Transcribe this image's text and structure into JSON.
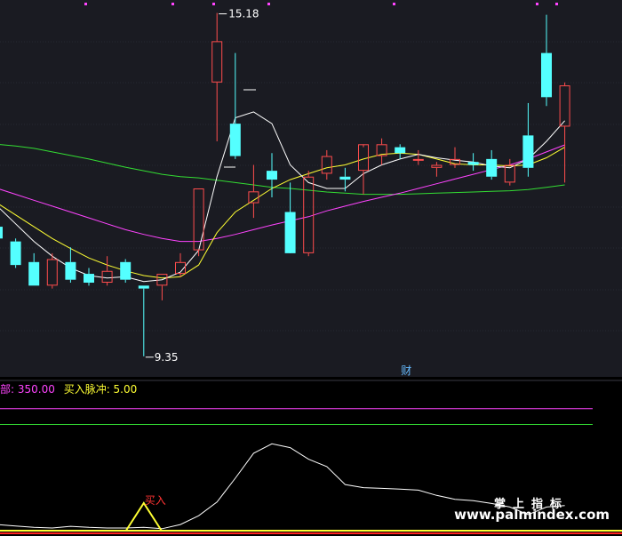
{
  "colors": {
    "background": "#000000",
    "panel_bg": "#1a1b22",
    "grid": "#262833",
    "candle_up": "#ff4d4d",
    "candle_down": "#54ffff",
    "ma_fast": "#ffffff",
    "ma_mid": "#ffff33",
    "ma_slow": "#ff44ff",
    "ma_long": "#33dd33",
    "label": "#ffffff",
    "legend_magenta": "#ff44ff",
    "legend_yellow": "#ffff33",
    "buy_label": "#ff3333",
    "signal_line": "#ffff33",
    "base_red": "#ff2222"
  },
  "main_chart": {
    "high_label": "15.18",
    "low_label": "9.35",
    "event_marker": "财"
  },
  "indicator": {
    "legend": [
      {
        "text": "部: 350.00",
        "color": "#ff44ff"
      },
      {
        "text": "买入脉冲: 5.00",
        "color": "#ffff33"
      }
    ],
    "buy_label": "买入"
  },
  "watermark": {
    "cn": "掌上指标",
    "url": "www.palmindex.com"
  },
  "chart_data": [
    {
      "type": "candlestick",
      "title": "",
      "price_range": [
        9.0,
        15.4
      ],
      "candles": [
        {
          "o": 11.55,
          "h": 11.65,
          "l": 11.35,
          "c": 11.35
        },
        {
          "o": 11.3,
          "h": 11.35,
          "l": 10.85,
          "c": 10.9
        },
        {
          "o": 10.95,
          "h": 11.1,
          "l": 10.55,
          "c": 10.55
        },
        {
          "o": 10.55,
          "h": 11.1,
          "l": 10.5,
          "c": 11.0
        },
        {
          "o": 10.95,
          "h": 11.2,
          "l": 10.6,
          "c": 10.65
        },
        {
          "o": 10.75,
          "h": 10.85,
          "l": 10.55,
          "c": 10.6
        },
        {
          "o": 10.6,
          "h": 11.05,
          "l": 10.55,
          "c": 10.8
        },
        {
          "o": 10.95,
          "h": 11.0,
          "l": 10.6,
          "c": 10.65
        },
        {
          "o": 10.55,
          "h": 10.55,
          "l": 9.35,
          "c": 10.5
        },
        {
          "o": 10.55,
          "h": 10.75,
          "l": 10.3,
          "c": 10.75
        },
        {
          "o": 10.75,
          "h": 11.1,
          "l": 10.7,
          "c": 10.95
        },
        {
          "o": 11.15,
          "h": 12.2,
          "l": 11.05,
          "c": 12.2
        },
        {
          "o": 14.0,
          "h": 15.18,
          "l": 13.0,
          "c": 14.7
        },
        {
          "o": 13.3,
          "h": 14.5,
          "l": 12.7,
          "c": 12.75
        },
        {
          "o": 11.95,
          "h": 12.6,
          "l": 11.7,
          "c": 12.15
        },
        {
          "o": 12.5,
          "h": 12.8,
          "l": 12.05,
          "c": 12.35
        },
        {
          "o": 11.8,
          "h": 12.3,
          "l": 11.5,
          "c": 11.1
        },
        {
          "o": 11.1,
          "h": 12.5,
          "l": 11.05,
          "c": 12.4
        },
        {
          "o": 12.45,
          "h": 12.85,
          "l": 12.35,
          "c": 12.75
        },
        {
          "o": 12.4,
          "h": 12.55,
          "l": 12.15,
          "c": 12.35
        },
        {
          "o": 12.5,
          "h": 12.9,
          "l": 12.1,
          "c": 12.95
        },
        {
          "o": 12.75,
          "h": 13.05,
          "l": 12.6,
          "c": 12.95
        },
        {
          "o": 12.9,
          "h": 12.95,
          "l": 12.7,
          "c": 12.8
        },
        {
          "o": 12.7,
          "h": 12.85,
          "l": 12.6,
          "c": 12.7
        },
        {
          "o": 12.55,
          "h": 12.65,
          "l": 12.4,
          "c": 12.6
        },
        {
          "o": 12.6,
          "h": 12.9,
          "l": 12.55,
          "c": 12.7
        },
        {
          "o": 12.65,
          "h": 12.8,
          "l": 12.5,
          "c": 12.6
        },
        {
          "o": 12.7,
          "h": 12.85,
          "l": 12.35,
          "c": 12.4
        },
        {
          "o": 12.3,
          "h": 12.7,
          "l": 12.25,
          "c": 12.6
        },
        {
          "o": 13.1,
          "h": 13.65,
          "l": 12.4,
          "c": 12.55
        },
        {
          "o": 14.5,
          "h": 15.15,
          "l": 13.6,
          "c": 13.75
        },
        {
          "o": 13.25,
          "h": 14.0,
          "l": 12.3,
          "c": 13.95
        }
      ],
      "ma_fast": [
        11.9,
        11.6,
        11.3,
        11.05,
        10.85,
        10.72,
        10.68,
        10.7,
        10.62,
        10.65,
        10.78,
        11.15,
        12.4,
        13.4,
        13.5,
        13.3,
        12.6,
        12.3,
        12.2,
        12.2,
        12.45,
        12.6,
        12.7,
        12.78,
        12.72,
        12.68,
        12.65,
        12.58,
        12.55,
        12.7,
        13.0,
        13.35
      ],
      "ma_mid": [
        11.95,
        11.75,
        11.55,
        11.35,
        11.18,
        11.02,
        10.9,
        10.8,
        10.72,
        10.68,
        10.7,
        10.9,
        11.45,
        11.8,
        12.0,
        12.2,
        12.35,
        12.45,
        12.55,
        12.6,
        12.7,
        12.78,
        12.8,
        12.78,
        12.7,
        12.62,
        12.6,
        12.6,
        12.58,
        12.6,
        12.72,
        12.9
      ],
      "ma_slow": [
        12.2,
        12.1,
        12.0,
        11.9,
        11.8,
        11.7,
        11.6,
        11.5,
        11.42,
        11.35,
        11.3,
        11.3,
        11.35,
        11.42,
        11.5,
        11.58,
        11.65,
        11.72,
        11.82,
        11.9,
        11.98,
        12.05,
        12.12,
        12.2,
        12.28,
        12.36,
        12.44,
        12.52,
        12.6,
        12.7,
        12.82,
        12.94
      ],
      "ma_long": [
        12.95,
        12.92,
        12.88,
        12.82,
        12.76,
        12.7,
        12.63,
        12.56,
        12.5,
        12.44,
        12.4,
        12.38,
        12.34,
        12.3,
        12.26,
        12.22,
        12.2,
        12.17,
        12.14,
        12.12,
        12.1,
        12.1,
        12.1,
        12.11,
        12.12,
        12.13,
        12.14,
        12.15,
        12.16,
        12.18,
        12.22,
        12.26
      ]
    },
    {
      "type": "line",
      "title": "",
      "ylim": [
        0,
        400
      ],
      "series": [
        {
          "values": [
            20,
            16,
            12,
            10,
            15,
            12,
            10,
            10,
            12,
            8,
            20,
            45,
            84,
            152,
            223,
            250,
            239,
            206,
            185,
            134,
            125,
            123,
            121,
            118,
            103,
            92,
            88,
            80,
            70,
            48,
            70,
            74
          ]
        }
      ],
      "levels": [
        350,
        305
      ],
      "signal_index": 8
    }
  ]
}
